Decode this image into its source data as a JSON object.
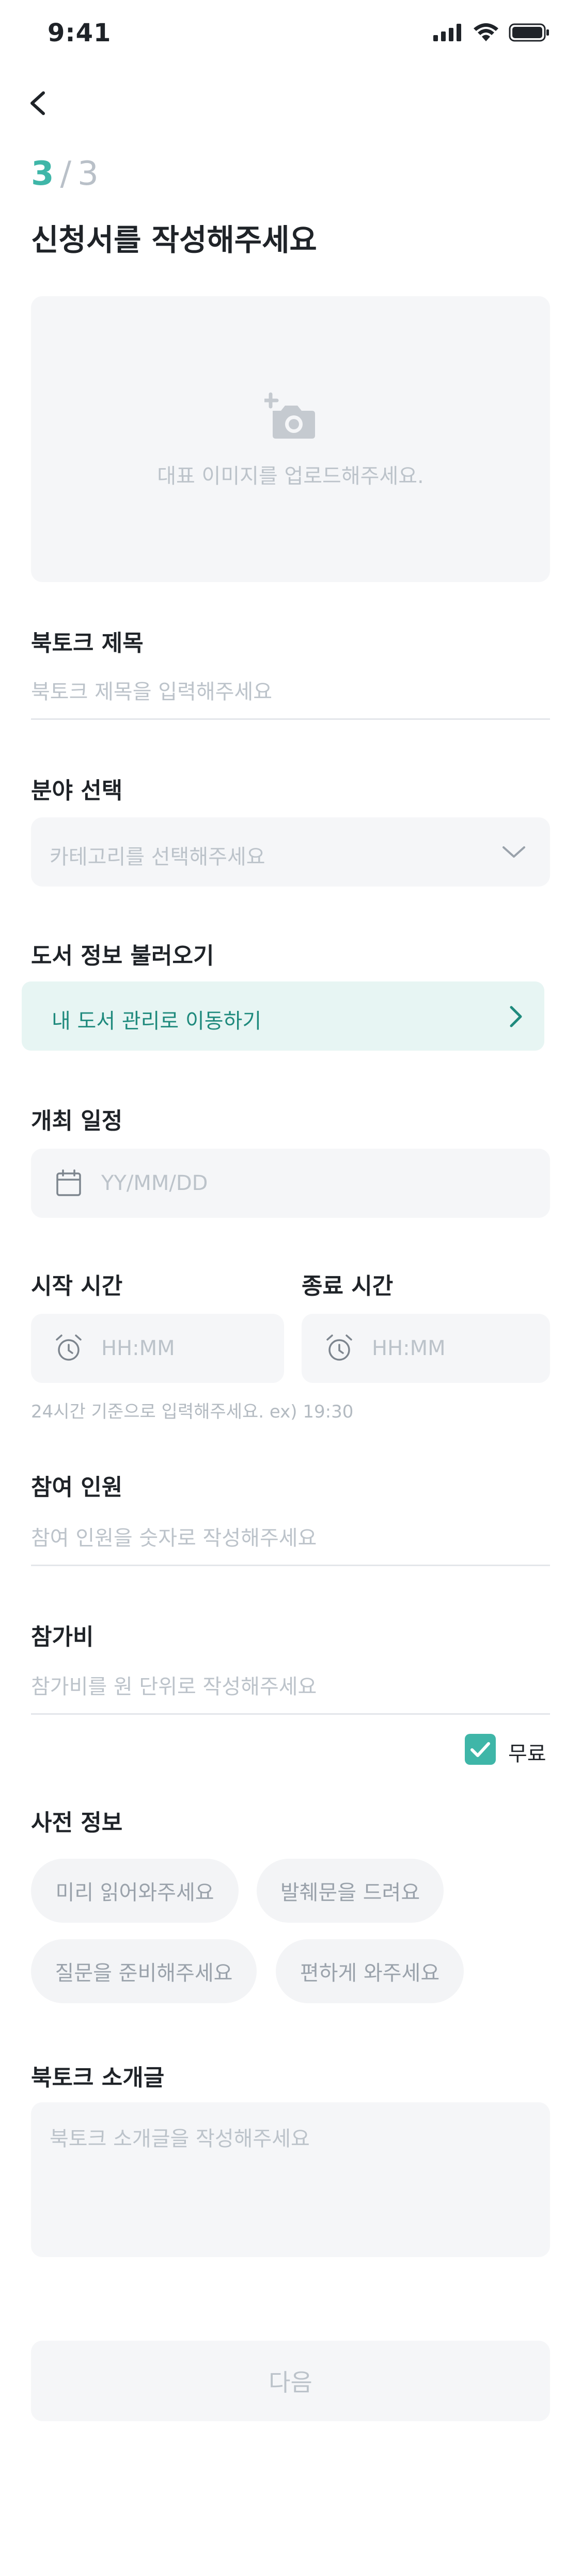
{
  "status_bar": {
    "time": "9:41"
  },
  "progress": {
    "current": "3",
    "separator": "/",
    "total": "3"
  },
  "page_title": "신청서를 작성해주세요",
  "image_upload": {
    "placeholder": "대표 이미지를 업로드해주세요."
  },
  "booktalk_title": {
    "label": "북토크 제목",
    "placeholder": "북토크 제목을 입력해주세요"
  },
  "category": {
    "label": "분야 선택",
    "placeholder": "카테고리를 선택해주세요"
  },
  "book_info": {
    "label": "도서 정보 불러오기",
    "button_label": "내 도서 관리로 이동하기"
  },
  "schedule": {
    "label": "개최 일정",
    "placeholder": "YY/MM/DD"
  },
  "start_time": {
    "label": "시작 시간",
    "placeholder": "HH:MM"
  },
  "end_time": {
    "label": "종료 시간",
    "placeholder": "HH:MM"
  },
  "time_hint": "24시간 기준으로 입력해주세요. ex) 19:30",
  "participants": {
    "label": "참여 인원",
    "placeholder": "참여 인원을 숫자로 작성해주세요"
  },
  "fee": {
    "label": "참가비",
    "placeholder": "참가비를 원 단위로 작성해주세요",
    "free_label": "무료",
    "free_checked": true
  },
  "pre_info": {
    "label": "사전 정보",
    "chips": [
      "미리 읽어와주세요",
      "발췌문을 드려요",
      "질문을 준비해주세요",
      "편하게 와주세요"
    ]
  },
  "intro": {
    "label": "북토크 소개글",
    "placeholder": "북토크 소개글을 작성해주세요"
  },
  "next_button": "다음",
  "colors": {
    "accent": "#3fb6a8",
    "accent_bg": "#e7f5f3",
    "accent_text": "#1f8a7d",
    "field_bg": "#f5f6f8"
  }
}
